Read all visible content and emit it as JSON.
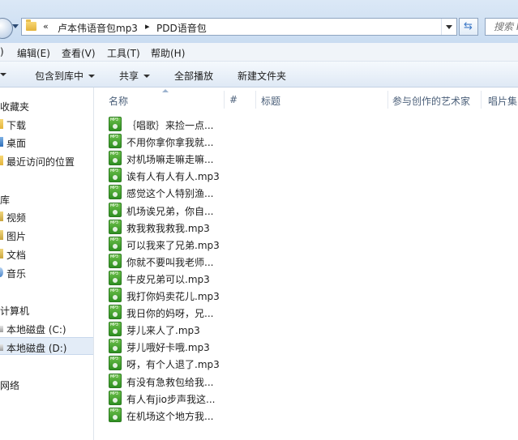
{
  "address": {
    "overflow_chevron": "«",
    "crumbs": [
      "卢本伟语音包mp3",
      "PDD语音包"
    ],
    "separator": "▸",
    "search_placeholder": "搜索 P"
  },
  "menu": {
    "items": [
      ")",
      "编辑(E)",
      "查看(V)",
      "工具(T)",
      "帮助(H)"
    ]
  },
  "commands": {
    "items": [
      "包含到库中",
      "共享",
      "全部播放",
      "新建文件夹"
    ]
  },
  "nav": {
    "favorites_header": "收藏夹",
    "favorites": [
      "下载",
      "桌面",
      "最近访问的位置"
    ],
    "libraries_header": "库",
    "libraries": [
      "视频",
      "图片",
      "文档",
      "音乐"
    ],
    "computer_header": "计算机",
    "drives": [
      "本地磁盘 (C:)",
      "本地磁盘 (D:)"
    ],
    "network_header": "网络"
  },
  "columns": [
    "名称",
    "#",
    "标题",
    "参与创作的艺术家",
    "唱片集"
  ],
  "files": [
    "｛唱歌｝来捡一点...",
    "不用你拿你拿我就...",
    "对机场嘛走嘛走嘛...",
    "诶有人有人有人.mp3",
    "感觉这个人特别渔...",
    "机场诶兄弟，你自...",
    "救我救我救我.mp3",
    "可以我来了兄弟.mp3",
    "你就不要叫我老师...",
    "牛皮兄弟可以.mp3",
    "我打你妈卖花儿.mp3",
    "我日你的妈呀，兄...",
    "芽儿来人了.mp3",
    "芽儿哦好卡哦.mp3",
    "呀，有个人退了.mp3",
    "有没有急救包给我...",
    "有人有jio步声我这...",
    "在机场这个地方我..."
  ],
  "colors": {
    "file_icon": "#3aa02a",
    "selected_nav": "#e3ecf7"
  }
}
